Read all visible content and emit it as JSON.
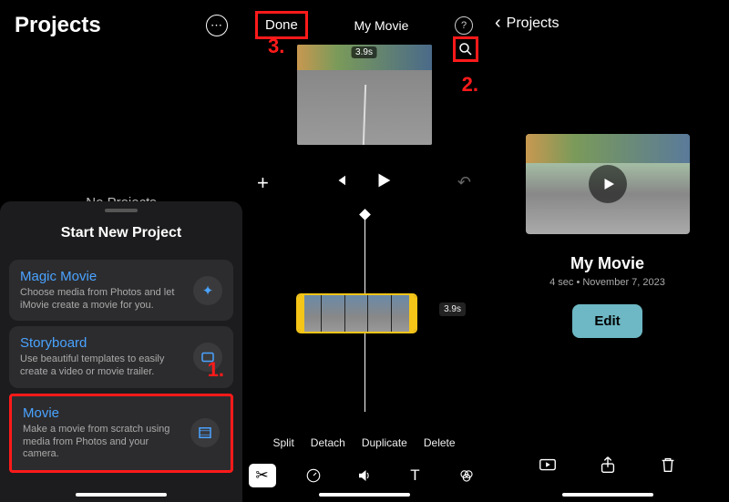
{
  "panel1": {
    "title": "Projects",
    "no_projects": "No Projects",
    "start_new": "Start New Project",
    "cards": [
      {
        "title": "Magic Movie",
        "desc": "Choose media from Photos and let iMovie create a movie for you.",
        "icon": "wand-icon"
      },
      {
        "title": "Storyboard",
        "desc": "Use beautiful templates to easily create a video or movie trailer.",
        "icon": "storyboard-icon"
      },
      {
        "title": "Movie",
        "desc": "Make a movie from scratch using media from Photos and your camera.",
        "icon": "film-icon"
      }
    ],
    "annotation": "1."
  },
  "panel2": {
    "done": "Done",
    "title": "My Movie",
    "preview_duration": "3.9s",
    "annotation_zoom": "2.",
    "annotation_done": "3.",
    "clip_duration": "3.9s",
    "edit_actions": [
      "Split",
      "Detach",
      "Duplicate",
      "Delete"
    ]
  },
  "panel3": {
    "back": "Projects",
    "movie_title": "My Movie",
    "meta": "4 sec • November 7, 2023",
    "edit": "Edit"
  }
}
